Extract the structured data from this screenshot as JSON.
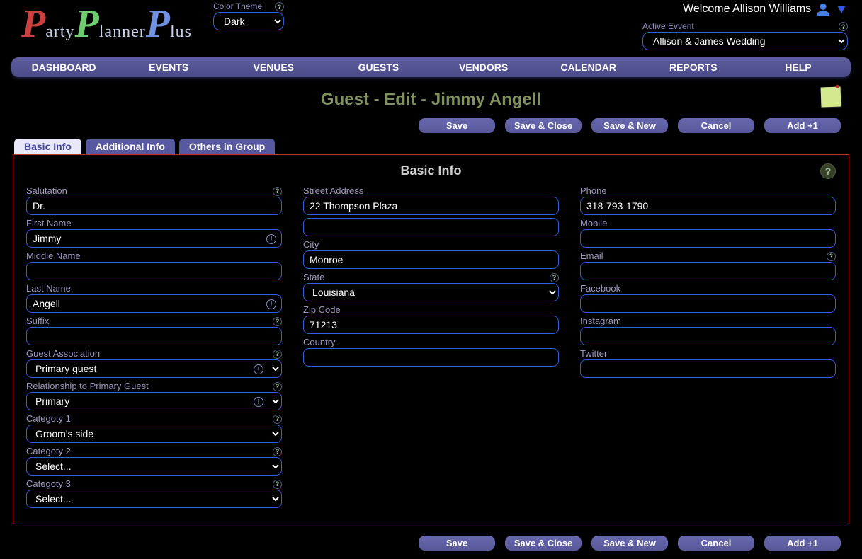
{
  "header": {
    "logo_parts": [
      "P",
      "arty",
      "P",
      "lanner",
      "P",
      "lus"
    ],
    "theme_label": "Color Theme",
    "theme_value": "Dark",
    "welcome": "Welcome Allison Williams",
    "active_event_label": "Active Evvent",
    "active_event_value": "Allison & James Wedding"
  },
  "nav": [
    "DASHBOARD",
    "EVENTS",
    "VENUES",
    "GUESTS",
    "VENDORS",
    "CALENDAR",
    "REPORTS",
    "HELP"
  ],
  "page_title": "Guest - Edit - Jimmy Angell",
  "buttons": {
    "save": "Save",
    "save_close": "Save & Close",
    "save_new": "Save & New",
    "cancel": "Cancel",
    "add1": "Add +1"
  },
  "tabs": {
    "basic": "Basic Info",
    "additional": "Additional Info",
    "others": "Others in Group"
  },
  "panel_title": "Basic Info",
  "fields": {
    "salutation": {
      "label": "Salutation",
      "value": "Dr."
    },
    "first_name": {
      "label": "First Name",
      "value": "Jimmy"
    },
    "middle_name": {
      "label": "Middle Name",
      "value": ""
    },
    "last_name": {
      "label": "Last Name",
      "value": "Angell"
    },
    "suffix": {
      "label": "Suffix",
      "value": ""
    },
    "guest_assoc": {
      "label": "Guest Association",
      "value": "Primary guest"
    },
    "relationship": {
      "label": "Relationship to Primary Guest",
      "value": "Primary"
    },
    "cat1": {
      "label": "Categoty 1",
      "value": "Groom's side"
    },
    "cat2": {
      "label": "Categoty 2",
      "value": "Select..."
    },
    "cat3": {
      "label": "Categoty 3",
      "value": "Select..."
    },
    "street": {
      "label": "Street Address",
      "value": "22 Thompson Plaza"
    },
    "street2": {
      "value": ""
    },
    "city": {
      "label": "City",
      "value": "Monroe"
    },
    "state": {
      "label": "State",
      "value": "Louisiana"
    },
    "zip": {
      "label": "Zip Code",
      "value": "71213"
    },
    "country": {
      "label": "Country",
      "value": ""
    },
    "phone": {
      "label": "Phone",
      "value": "318-793-1790"
    },
    "mobile": {
      "label": "Mobile",
      "value": ""
    },
    "email": {
      "label": "Email",
      "value": ""
    },
    "facebook": {
      "label": "Facebook",
      "value": ""
    },
    "instagram": {
      "label": "Instagram",
      "value": ""
    },
    "twitter": {
      "label": "Twitter",
      "value": ""
    }
  }
}
